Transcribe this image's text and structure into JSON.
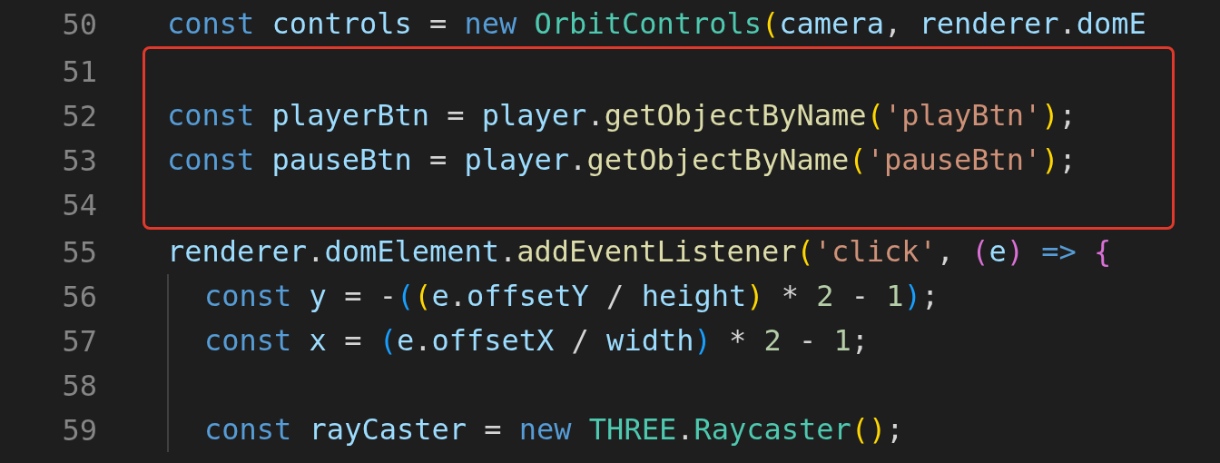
{
  "blocks": [
    {
      "highlighted": false,
      "lines": [
        {
          "number": "50",
          "indented": false,
          "tokens": [
            {
              "text": "const ",
              "kind": "kw"
            },
            {
              "text": "controls",
              "kind": "var"
            },
            {
              "text": " = ",
              "kind": "op"
            },
            {
              "text": "new ",
              "kind": "kw"
            },
            {
              "text": "OrbitControls",
              "kind": "cls"
            },
            {
              "text": "(",
              "kind": "br1"
            },
            {
              "text": "camera",
              "kind": "var"
            },
            {
              "text": ", ",
              "kind": "op"
            },
            {
              "text": "renderer",
              "kind": "var"
            },
            {
              "text": ".",
              "kind": "op"
            },
            {
              "text": "domE",
              "kind": "var"
            }
          ]
        }
      ]
    },
    {
      "highlighted": true,
      "lines": [
        {
          "number": "51",
          "indented": false
        },
        {
          "number": "52",
          "indented": false,
          "tokens": [
            {
              "text": "const ",
              "kind": "kw"
            },
            {
              "text": "playerBtn",
              "kind": "var"
            },
            {
              "text": " = ",
              "kind": "op"
            },
            {
              "text": "player",
              "kind": "var"
            },
            {
              "text": ".",
              "kind": "op"
            },
            {
              "text": "getObjectByName",
              "kind": "fn"
            },
            {
              "text": "(",
              "kind": "br1"
            },
            {
              "text": "'playBtn'",
              "kind": "str"
            },
            {
              "text": ")",
              "kind": "br1"
            },
            {
              "text": ";",
              "kind": "op"
            }
          ]
        },
        {
          "number": "53",
          "indented": false,
          "tokens": [
            {
              "text": "const ",
              "kind": "kw"
            },
            {
              "text": "pauseBtn",
              "kind": "var"
            },
            {
              "text": " = ",
              "kind": "op"
            },
            {
              "text": "player",
              "kind": "var"
            },
            {
              "text": ".",
              "kind": "op"
            },
            {
              "text": "getObjectByName",
              "kind": "fn"
            },
            {
              "text": "(",
              "kind": "br1"
            },
            {
              "text": "'pauseBtn'",
              "kind": "str"
            },
            {
              "text": ")",
              "kind": "br1"
            },
            {
              "text": ";",
              "kind": "op"
            }
          ]
        },
        {
          "number": "54",
          "indented": false
        }
      ]
    },
    {
      "highlighted": false,
      "lines": [
        {
          "number": "55",
          "indented": false,
          "tokens": [
            {
              "text": "renderer",
              "kind": "var"
            },
            {
              "text": ".",
              "kind": "op"
            },
            {
              "text": "domElement",
              "kind": "var"
            },
            {
              "text": ".",
              "kind": "op"
            },
            {
              "text": "addEventListener",
              "kind": "fn"
            },
            {
              "text": "(",
              "kind": "br1"
            },
            {
              "text": "'click'",
              "kind": "str"
            },
            {
              "text": ", ",
              "kind": "op"
            },
            {
              "text": "(",
              "kind": "br2"
            },
            {
              "text": "e",
              "kind": "var"
            },
            {
              "text": ")",
              "kind": "br2"
            },
            {
              "text": " => ",
              "kind": "kw"
            },
            {
              "text": "{",
              "kind": "br2"
            }
          ]
        },
        {
          "number": "56",
          "indented": true,
          "tokens": [
            {
              "text": "const ",
              "kind": "kw"
            },
            {
              "text": "y",
              "kind": "var"
            },
            {
              "text": " = ",
              "kind": "op"
            },
            {
              "text": "-",
              "kind": "op"
            },
            {
              "text": "(",
              "kind": "br3"
            },
            {
              "text": "(",
              "kind": "br1"
            },
            {
              "text": "e",
              "kind": "var"
            },
            {
              "text": ".",
              "kind": "op"
            },
            {
              "text": "offsetY",
              "kind": "var"
            },
            {
              "text": " / ",
              "kind": "op"
            },
            {
              "text": "height",
              "kind": "var"
            },
            {
              "text": ")",
              "kind": "br1"
            },
            {
              "text": " * ",
              "kind": "op"
            },
            {
              "text": "2",
              "kind": "num"
            },
            {
              "text": " - ",
              "kind": "op"
            },
            {
              "text": "1",
              "kind": "num"
            },
            {
              "text": ")",
              "kind": "br3"
            },
            {
              "text": ";",
              "kind": "op"
            }
          ]
        },
        {
          "number": "57",
          "indented": true,
          "tokens": [
            {
              "text": "const ",
              "kind": "kw"
            },
            {
              "text": "x",
              "kind": "var"
            },
            {
              "text": " = ",
              "kind": "op"
            },
            {
              "text": "(",
              "kind": "br3"
            },
            {
              "text": "e",
              "kind": "var"
            },
            {
              "text": ".",
              "kind": "op"
            },
            {
              "text": "offsetX",
              "kind": "var"
            },
            {
              "text": " / ",
              "kind": "op"
            },
            {
              "text": "width",
              "kind": "var"
            },
            {
              "text": ")",
              "kind": "br3"
            },
            {
              "text": " * ",
              "kind": "op"
            },
            {
              "text": "2",
              "kind": "num"
            },
            {
              "text": " - ",
              "kind": "op"
            },
            {
              "text": "1",
              "kind": "num"
            },
            {
              "text": ";",
              "kind": "op"
            }
          ]
        },
        {
          "number": "58",
          "indented": true
        },
        {
          "number": "59",
          "indented": true,
          "tokens": [
            {
              "text": "const ",
              "kind": "kw"
            },
            {
              "text": "rayCaster",
              "kind": "var"
            },
            {
              "text": " = ",
              "kind": "op"
            },
            {
              "text": "new ",
              "kind": "kw"
            },
            {
              "text": "THREE",
              "kind": "cls"
            },
            {
              "text": ".",
              "kind": "op"
            },
            {
              "text": "Raycaster",
              "kind": "cls"
            },
            {
              "text": "(",
              "kind": "br1"
            },
            {
              "text": ")",
              "kind": "br1"
            },
            {
              "text": ";",
              "kind": "op"
            }
          ]
        }
      ]
    }
  ]
}
